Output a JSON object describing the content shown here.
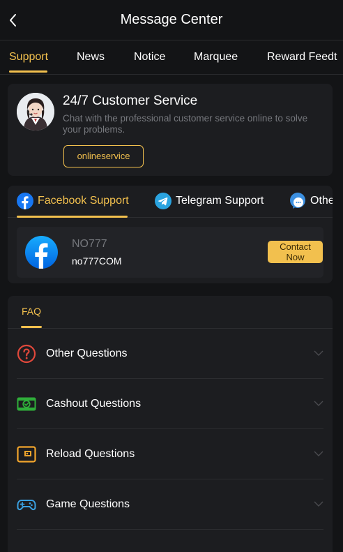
{
  "header": {
    "title": "Message Center",
    "back_icon": "chevron-left-icon"
  },
  "tabs": [
    {
      "label": "Support",
      "active": true
    },
    {
      "label": "News",
      "active": false
    },
    {
      "label": "Notice",
      "active": false
    },
    {
      "label": "Marquee",
      "active": false
    },
    {
      "label": "Reward Feedt",
      "active": false
    }
  ],
  "customer_service": {
    "title": "24/7 Customer Service",
    "description": "Chat with the professional customer service online to solve your problems.",
    "button_label": "onlineservice"
  },
  "social_tabs": [
    {
      "label": "Facebook Support",
      "icon": "facebook-icon",
      "active": true
    },
    {
      "label": "Telegram Support",
      "icon": "telegram-icon",
      "active": false
    },
    {
      "label": "Othe",
      "icon": "chat-bubble-icon",
      "active": false
    }
  ],
  "contact": {
    "name": "NO777",
    "id": "no777COM",
    "button_line1": "Contact",
    "button_line2": "Now"
  },
  "faq": {
    "tab_label": "FAQ",
    "items": [
      {
        "label": "Other Questions",
        "icon": "question-circle-icon"
      },
      {
        "label": "Cashout Questions",
        "icon": "cashout-icon"
      },
      {
        "label": "Reload Questions",
        "icon": "wallet-icon"
      },
      {
        "label": "Game Questions",
        "icon": "gamepad-icon"
      }
    ]
  },
  "colors": {
    "accent": "#f2c04e",
    "background": "#131416",
    "card": "#1c1d20",
    "muted_text": "#76787d"
  }
}
